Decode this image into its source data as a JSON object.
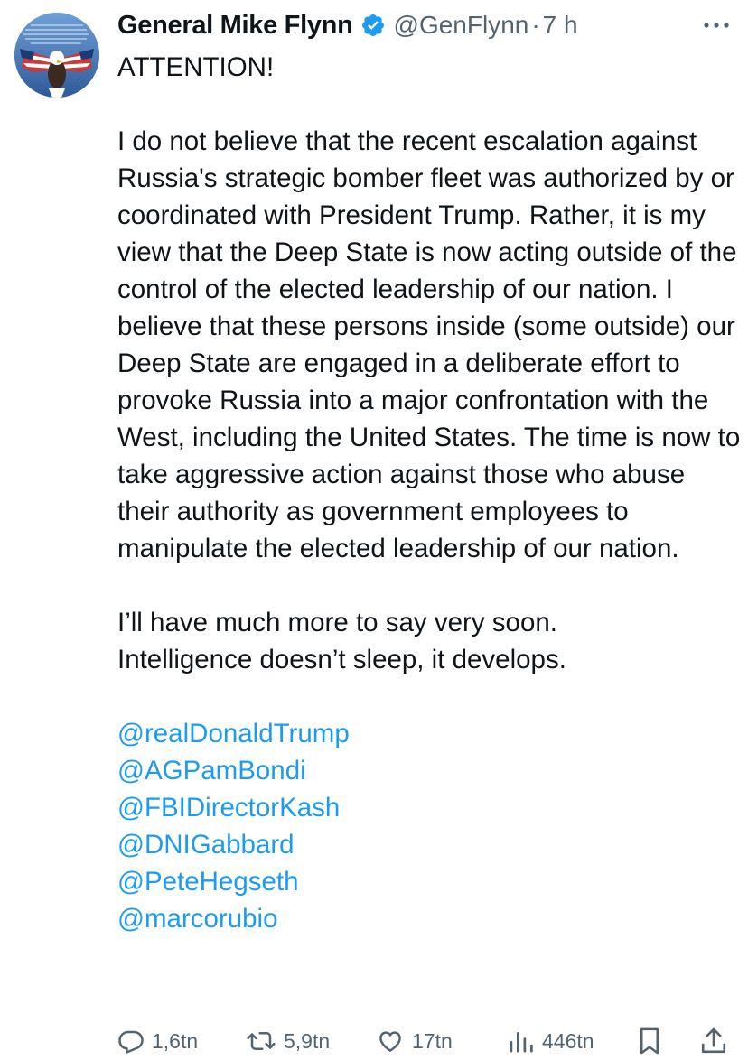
{
  "author": {
    "name": "General Mike Flynn",
    "handle": "@GenFlynn",
    "separator": "·",
    "time": "7 h",
    "verified": true,
    "verified_color": "#1d9bf0"
  },
  "tweet": {
    "headline": "ATTENTION!",
    "paragraph_1": "I do not believe that the recent escalation against Russia's strategic bomber fleet was authorized by or coordinated with President Trump.  Rather, it is my view that the Deep State is now acting outside of the control of the elected leadership of our nation.  I believe that these persons inside (some outside) our Deep State are engaged in a deliberate effort to provoke Russia into a major confrontation with the West, including the United States. The time is now to take aggressive action against those who abuse their authority as government employees to manipulate the elected leadership of our nation.",
    "paragraph_2_line_1": "I’ll have much more to say very soon.",
    "paragraph_2_line_2": "Intelligence doesn’t sleep, it develops.",
    "mentions": [
      "@realDonaldTrump",
      "@AGPamBondi",
      "@FBIDirectorKash",
      "@DNIGabbard",
      "@PeteHegseth",
      "@marcorubio"
    ],
    "mention_color": "#1d9bf0"
  },
  "actions": {
    "replies": "1,6tn",
    "reposts": "5,9tn",
    "likes": "17tn",
    "views": "446tn",
    "icons": [
      "reply-icon",
      "repost-icon",
      "like-icon",
      "views-icon",
      "bookmark-icon",
      "share-icon"
    ]
  }
}
